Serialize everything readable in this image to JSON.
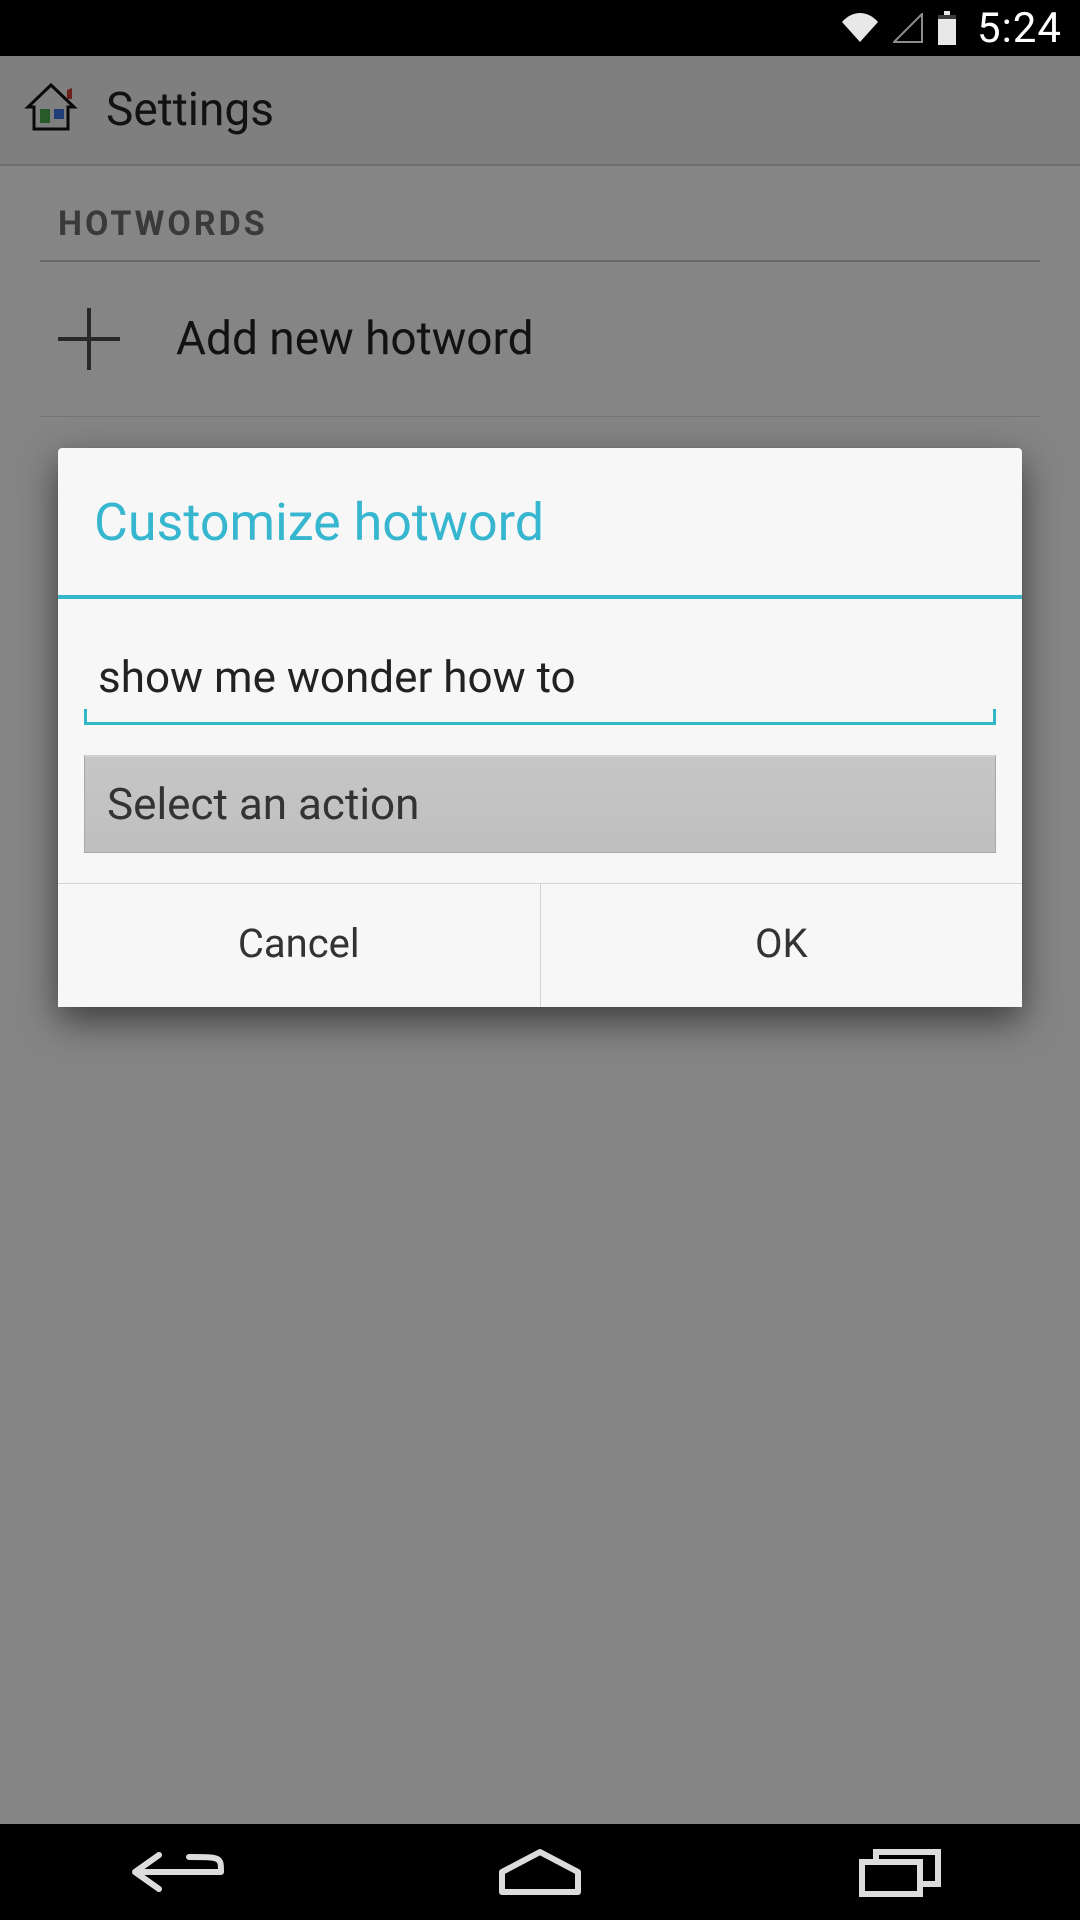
{
  "status_bar": {
    "time": "5:24"
  },
  "action_bar": {
    "title": "Settings"
  },
  "section": {
    "header": "HOTWORDS"
  },
  "list": {
    "add_item": {
      "label": "Add new hotword"
    }
  },
  "dialog": {
    "title": "Customize hotword",
    "input_value": "show me wonder how to",
    "action_spinner": {
      "label": "Select an action"
    },
    "cancel_label": "Cancel",
    "ok_label": "OK"
  },
  "colors": {
    "accent": "#37b6cf",
    "scrim": "rgba(0,0,0,0.45)"
  }
}
